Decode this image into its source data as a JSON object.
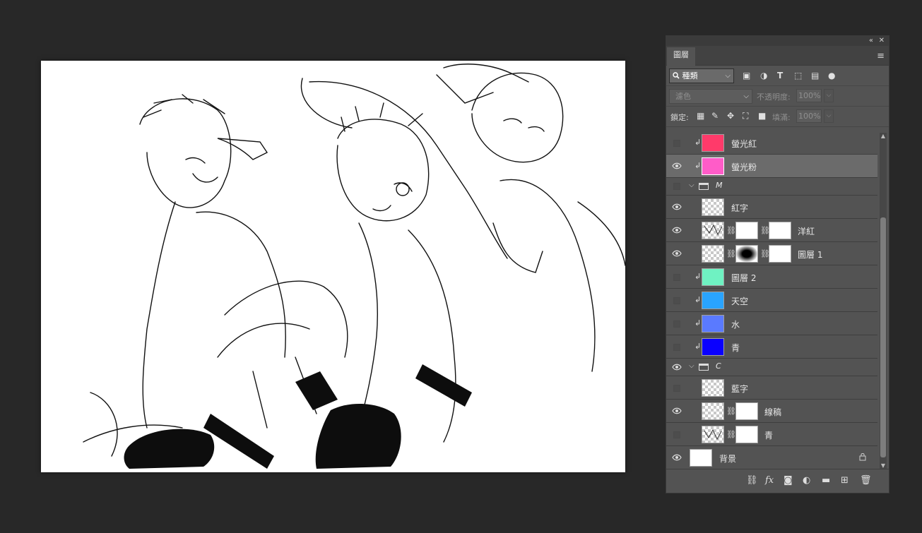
{
  "panel": {
    "collapse_icon": "«",
    "close_icon": "✕",
    "tab_label": "圖層",
    "menu_icon": "≡",
    "filter": {
      "value": "種類",
      "caret": "⌵",
      "search_icon": "magnifier-icon"
    },
    "blend": {
      "value": "濾色",
      "caret": "⌵"
    },
    "opacity": {
      "label": "不透明度:",
      "value": "100%",
      "caret": "⌵"
    },
    "lock": {
      "label": "鎖定:"
    },
    "fill": {
      "label": "填滿:",
      "value": "100%",
      "caret": "⌵"
    }
  },
  "layers": [
    {
      "name": "螢光紅",
      "visible": false,
      "clip": true,
      "color": "#ff3a6a"
    },
    {
      "name": "螢光粉",
      "visible": true,
      "clip": true,
      "color": "#ff5cc8",
      "selected": true
    },
    {
      "name": "M",
      "group": true,
      "visible": false
    },
    {
      "name": "紅字",
      "visible": true,
      "thumb": "checker"
    },
    {
      "name": "洋紅",
      "visible": true,
      "thumb": "sketch",
      "masks": 2
    },
    {
      "name": "圖層 1",
      "visible": true,
      "thumb": "checker",
      "masks": 2
    },
    {
      "name": "圖層 2",
      "visible": false,
      "clip": true,
      "color": "#6ff2c2"
    },
    {
      "name": "天空",
      "visible": false,
      "clip": true,
      "color": "#29a4ff"
    },
    {
      "name": "水",
      "visible": false,
      "clip": true,
      "color": "#5a7aff"
    },
    {
      "name": "青",
      "visible": false,
      "clip": true,
      "color": "#0a00ff"
    },
    {
      "name": "C",
      "group": true,
      "visible": true
    },
    {
      "name": "藍字",
      "visible": false,
      "thumb": "checker"
    },
    {
      "name": "線稿",
      "visible": true,
      "thumb": "checker",
      "masks": 1
    },
    {
      "name": "青",
      "visible": false,
      "thumb": "sketch",
      "masks": 1
    },
    {
      "name": "背景",
      "visible": true,
      "thumb": "white",
      "locked": true
    }
  ],
  "icons": {
    "clip": "↲",
    "link": "⛓",
    "lock": "🔒",
    "scroll_up": "▲",
    "scroll_down": "▼"
  },
  "bottom_icons": [
    "link-layers-icon",
    "fx-icon",
    "mask-icon",
    "adjustment-icon",
    "folder-icon",
    "new-layer-icon",
    "trash-icon"
  ],
  "bottom": {
    "fx_label": "fx"
  }
}
